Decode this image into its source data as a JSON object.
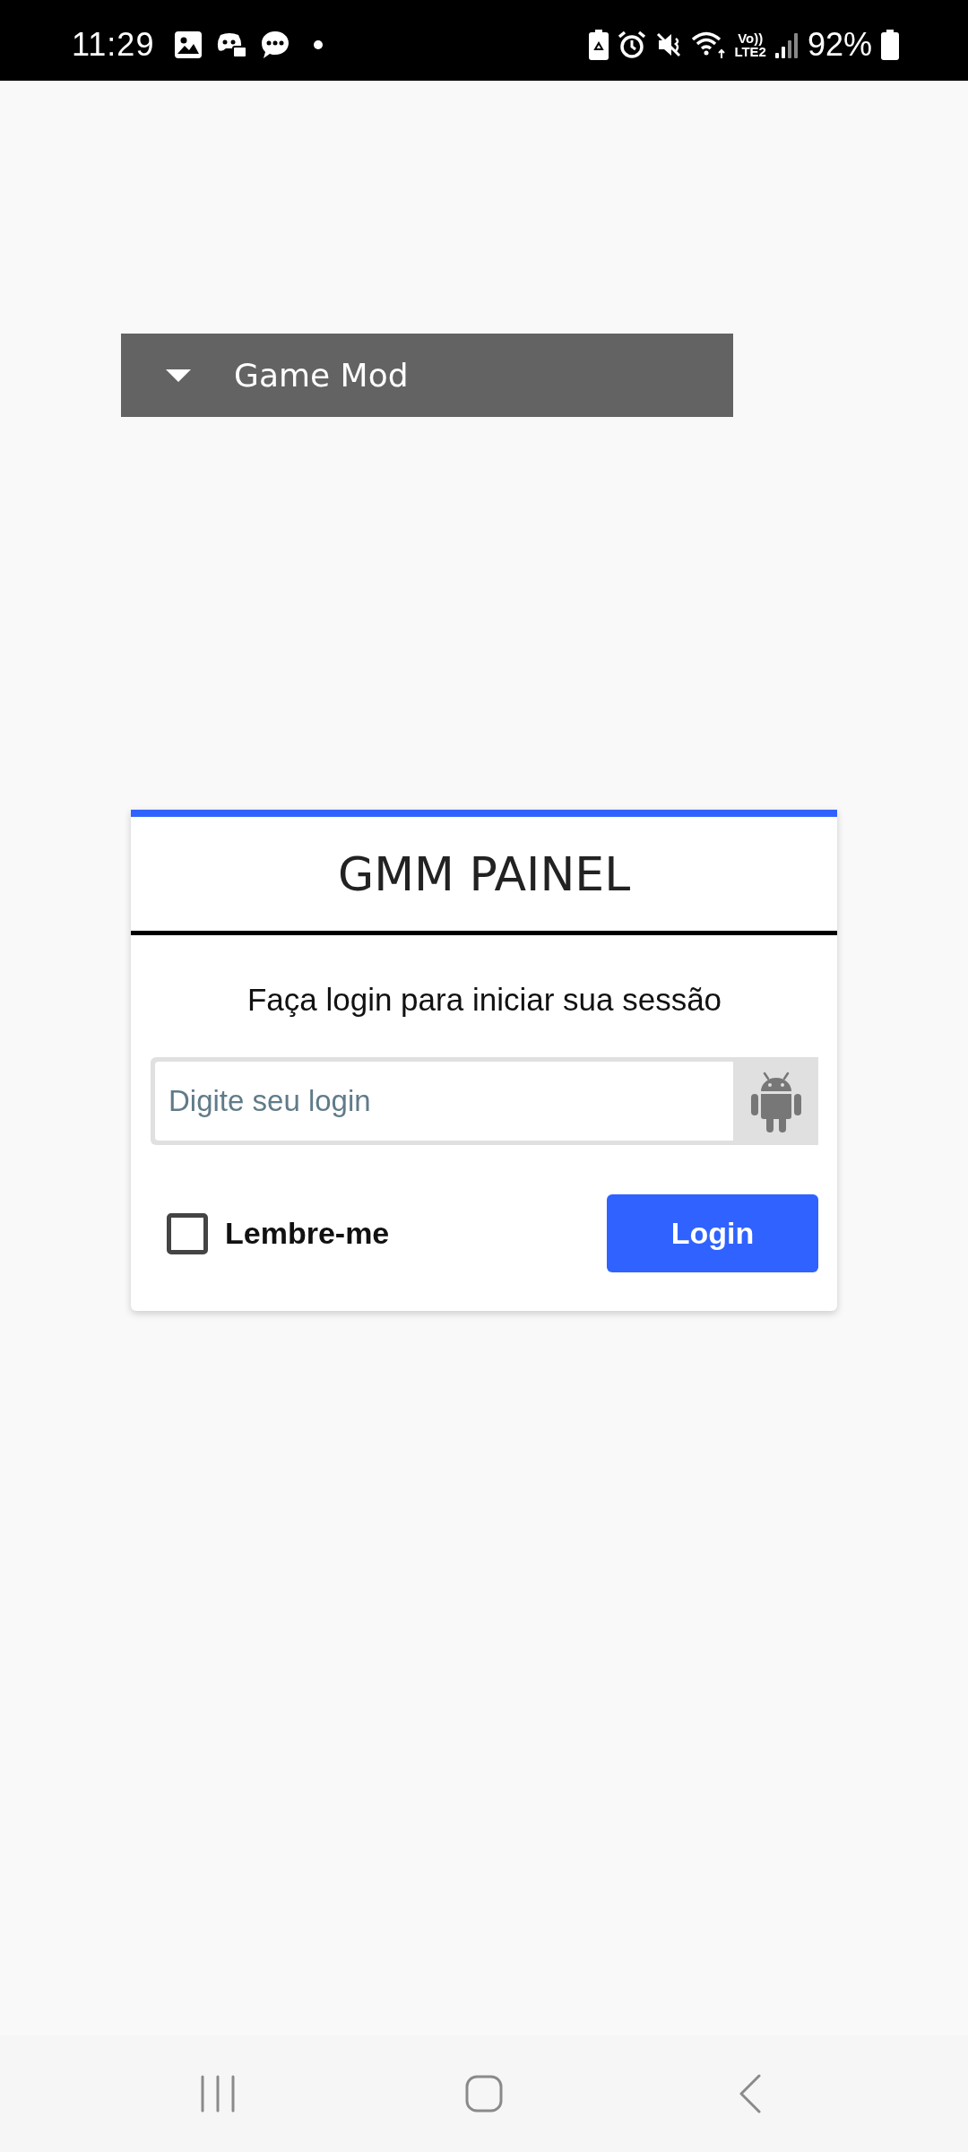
{
  "status_bar": {
    "time": "11:29",
    "network_labels": [
      "Vo))",
      "LTE2"
    ],
    "battery": "92%"
  },
  "dropdown": {
    "label": "Game Mod"
  },
  "login_card": {
    "title": "GMM PAINEL",
    "subtitle": "Faça login para iniciar sua sessão",
    "login_field": {
      "placeholder": "Digite seu login"
    },
    "remember": {
      "label": "Lembre-me",
      "checked": false
    },
    "submit_button": "Login"
  }
}
